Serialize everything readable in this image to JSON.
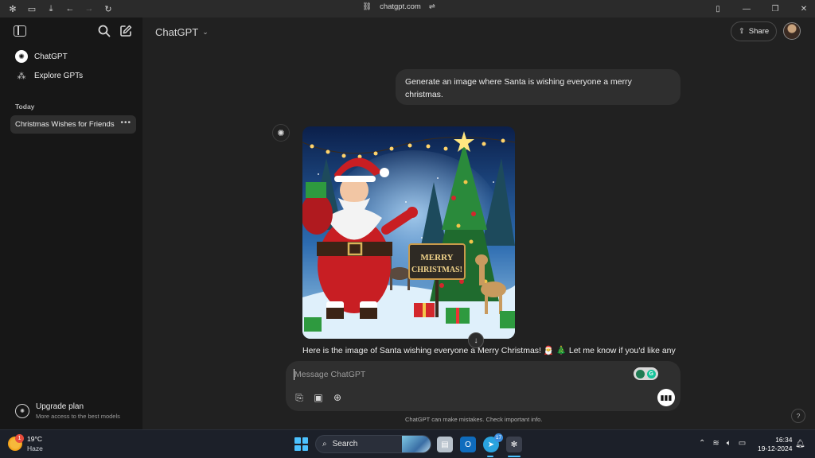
{
  "browser": {
    "url": "chatgpt.com"
  },
  "sidebar": {
    "nav": [
      {
        "label": "ChatGPT",
        "icon": "openai-logo-icon"
      },
      {
        "label": "Explore GPTs",
        "icon": "grid-icon"
      }
    ],
    "section_label": "Today",
    "chats": [
      {
        "title": "Christmas Wishes for Friends"
      }
    ],
    "upgrade": {
      "title": "Upgrade plan",
      "subtitle": "More access to the best models"
    }
  },
  "header": {
    "model": "ChatGPT",
    "share_label": "Share"
  },
  "conversation": {
    "user_message": "Generate an image where Santa is wishing everyone a merry christmas.",
    "assistant_message": "Here is the image of Santa wishing everyone a Merry Christmas! 🎅 🎄 Let me know if you'd like any",
    "image": {
      "sign_line1": "MERRY",
      "sign_line2": "CHRISTMAS!"
    }
  },
  "composer": {
    "placeholder": "Message ChatGPT"
  },
  "footer": {
    "disclaimer": "ChatGPT can make mistakes. Check important info.",
    "help": "?"
  },
  "taskbar": {
    "weather": {
      "temp": "19°C",
      "condition": "Haze",
      "badge": "1"
    },
    "search_label": "Search",
    "telegram_count": "17",
    "time": "16:34",
    "date": "19-12-2024"
  },
  "colors": {
    "sidebar_bg": "#171717",
    "main_bg": "#212121",
    "bubble_bg": "#2f2f2f",
    "taskbar_bg": "#1c2029",
    "accent": "#4cc2ff"
  }
}
